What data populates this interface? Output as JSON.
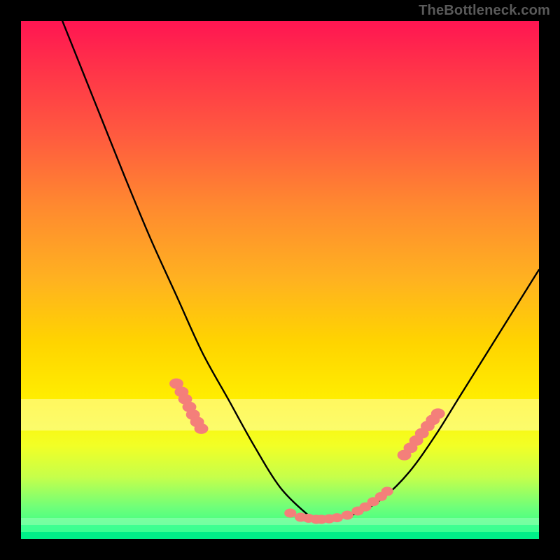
{
  "attribution": "TheBottleneck.com",
  "colors": {
    "frame": "#000000",
    "gradient_top": "#ff1552",
    "gradient_mid": "#ffd400",
    "gradient_bottom": "#1eff8d",
    "curve": "#000000",
    "marker": "#f47f7a",
    "pale_band": "#ffffb0"
  },
  "chart_data": {
    "type": "line",
    "title": "",
    "xlabel": "",
    "ylabel": "",
    "xlim": [
      0,
      100
    ],
    "ylim": [
      0,
      100
    ],
    "grid": false,
    "series": [
      {
        "name": "bottleneck-curve",
        "x": [
          8,
          12,
          16,
          20,
          25,
          30,
          35,
          40,
          45,
          50,
          55,
          57,
          60,
          65,
          70,
          75,
          80,
          85,
          90,
          95,
          100
        ],
        "y": [
          100,
          90,
          80,
          70,
          58,
          47,
          36,
          27,
          18,
          10,
          5,
          4,
          4,
          5,
          8,
          13,
          20,
          28,
          36,
          44,
          52
        ]
      }
    ],
    "markers": {
      "description": "highlighted points near the curve's trough and its shoulders",
      "left_cluster_x": [
        30,
        31,
        31.7,
        32.5,
        33.2,
        34,
        34.8
      ],
      "left_cluster_y": [
        30,
        28.4,
        27,
        25.5,
        24,
        22.6,
        21.3
      ],
      "bottom_cluster_x": [
        52,
        54,
        55.5,
        57,
        58,
        59.5,
        61,
        63,
        65,
        66.5,
        68,
        69.5,
        70.7
      ],
      "bottom_cluster_y": [
        5.0,
        4.2,
        4.0,
        3.8,
        3.8,
        3.9,
        4.1,
        4.6,
        5.4,
        6.2,
        7.2,
        8.2,
        9.2
      ],
      "right_cluster_x": [
        74,
        75.2,
        76.3,
        77.4,
        78.5,
        79.5,
        80.5
      ],
      "right_cluster_y": [
        16.2,
        17.6,
        19,
        20.4,
        21.8,
        23,
        24.2
      ]
    },
    "bands": [
      {
        "name": "pale-yellow-band",
        "y_from": 21,
        "y_to": 27
      },
      {
        "name": "green-band",
        "y_from": 0,
        "y_to": 4
      }
    ]
  }
}
